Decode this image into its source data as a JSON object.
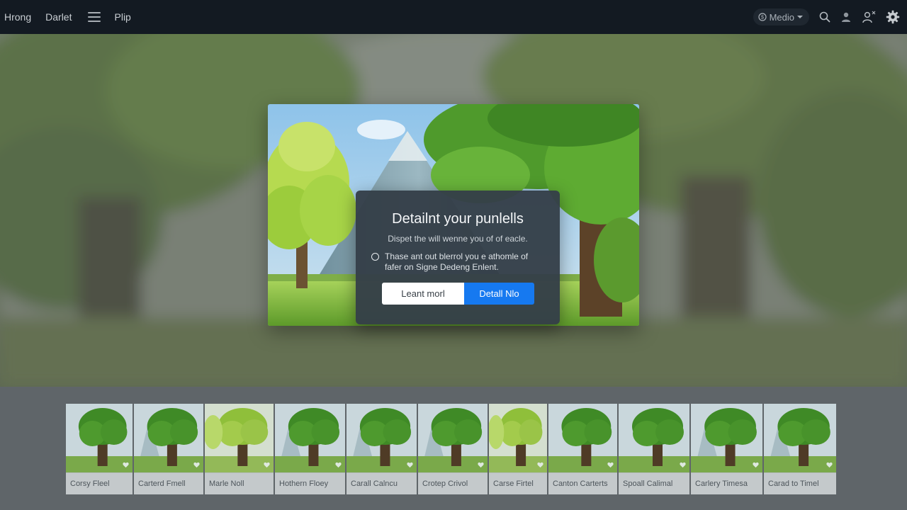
{
  "topbar": {
    "nav": [
      "Hrong",
      "Darlet",
      "Plip"
    ],
    "media_label": "Medio"
  },
  "dialog": {
    "title": "Detailnt your punlells",
    "subtitle": "Dispet the will wenne you of of eacle.",
    "option_text": "Thase ant out blerrol you e athomle of fafer on Signe Dedeng Enlent.",
    "secondary_button": "Leant morl",
    "primary_button": "Detall Nlo"
  },
  "gallery": [
    {
      "caption": "Corsy Fleel",
      "variant": "tree"
    },
    {
      "caption": "Carterd Fmell",
      "variant": "pyramid"
    },
    {
      "caption": "Marle Noll",
      "variant": "light"
    },
    {
      "caption": "Hothern Floey",
      "variant": "pyramid"
    },
    {
      "caption": "Carall Calncu",
      "variant": "pyramid"
    },
    {
      "caption": "Crotep Crivol",
      "variant": "pyramid"
    },
    {
      "caption": "Carse Firtel",
      "variant": "light"
    },
    {
      "caption": "Canton Carterts",
      "variant": "tree"
    },
    {
      "caption": "Spoall Calimal",
      "variant": "tree"
    },
    {
      "caption": "Carlery Timesa",
      "variant": "pyramid"
    },
    {
      "caption": "Carad to Timel",
      "variant": "pyramid"
    }
  ],
  "colors": {
    "topbar_bg": "#131a22",
    "primary": "#1679f0",
    "dialog_bg": "#343e48"
  }
}
